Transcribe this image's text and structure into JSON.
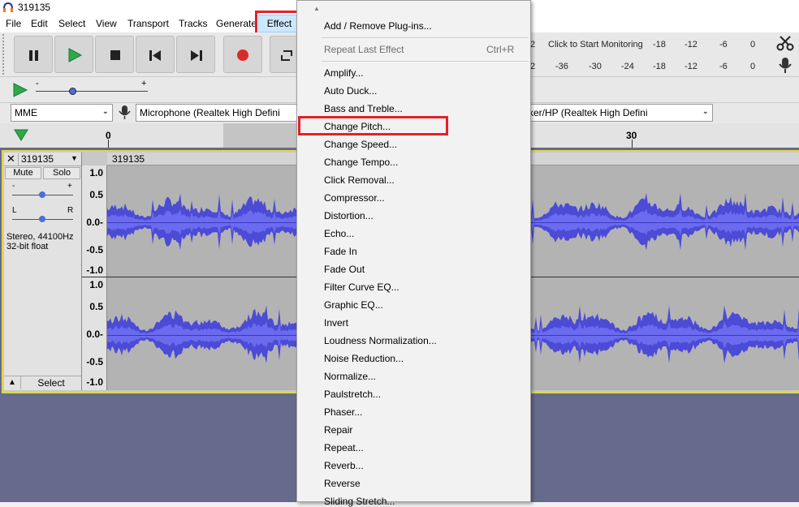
{
  "window": {
    "title": "319135"
  },
  "menubar": {
    "items": [
      "File",
      "Edit",
      "Select",
      "View",
      "Transport",
      "Tracks",
      "Generate",
      "Effect"
    ]
  },
  "transport": {
    "buttons": [
      "pause",
      "play",
      "stop",
      "skip-to-start",
      "skip-to-end",
      "record",
      "loop"
    ]
  },
  "meters": {
    "record_ticks": [
      "2",
      "Click to Start Monitoring",
      "-18",
      "-12",
      "-6",
      "0"
    ],
    "play_ticks": [
      "2",
      "-36",
      "-30",
      "-24",
      "-18",
      "-12",
      "-6",
      "0"
    ]
  },
  "devices": {
    "host": "MME",
    "input": "Microphone (Realtek High Defini",
    "output": "ker/HP (Realtek High Defini"
  },
  "timeline": {
    "ticks": [
      "0",
      "30"
    ]
  },
  "track": {
    "name": "319135",
    "clip_name": "319135",
    "mute_label": "Mute",
    "solo_label": "Solo",
    "gain_minus": "-",
    "gain_plus": "+",
    "pan_left": "L",
    "pan_right": "R",
    "info_rate": "Stereo, 44100Hz",
    "info_format": "32-bit float",
    "select_label": "Select",
    "scale_top": [
      "1.0",
      "0.5",
      "0.0-",
      "-0.5",
      "-1.0"
    ],
    "scale_bottom": [
      "1.0",
      "0.5",
      "0.0-",
      "-0.5",
      "-1.0"
    ]
  },
  "effect_menu": {
    "add_remove": "Add / Remove Plug-ins...",
    "repeat_last": "Repeat Last Effect",
    "repeat_last_shortcut": "Ctrl+R",
    "items": [
      "Amplify...",
      "Auto Duck...",
      "Bass and Treble...",
      "Change Pitch...",
      "Change Speed...",
      "Change Tempo...",
      "Click Removal...",
      "Compressor...",
      "Distortion...",
      "Echo...",
      "Fade In",
      "Fade Out",
      "Filter Curve EQ...",
      "Graphic EQ...",
      "Invert",
      "Loudness Normalization...",
      "Noise Reduction...",
      "Normalize...",
      "Paulstretch...",
      "Phaser...",
      "Repair",
      "Repeat...",
      "Reverb...",
      "Reverse",
      "Sliding Stretch..."
    ]
  },
  "colors": {
    "waveform": "#4b4bd6",
    "highlight_box": "#e32129",
    "track_border": "#e0d84c",
    "record_red": "#d92b2b",
    "play_green": "#2ea84b"
  }
}
